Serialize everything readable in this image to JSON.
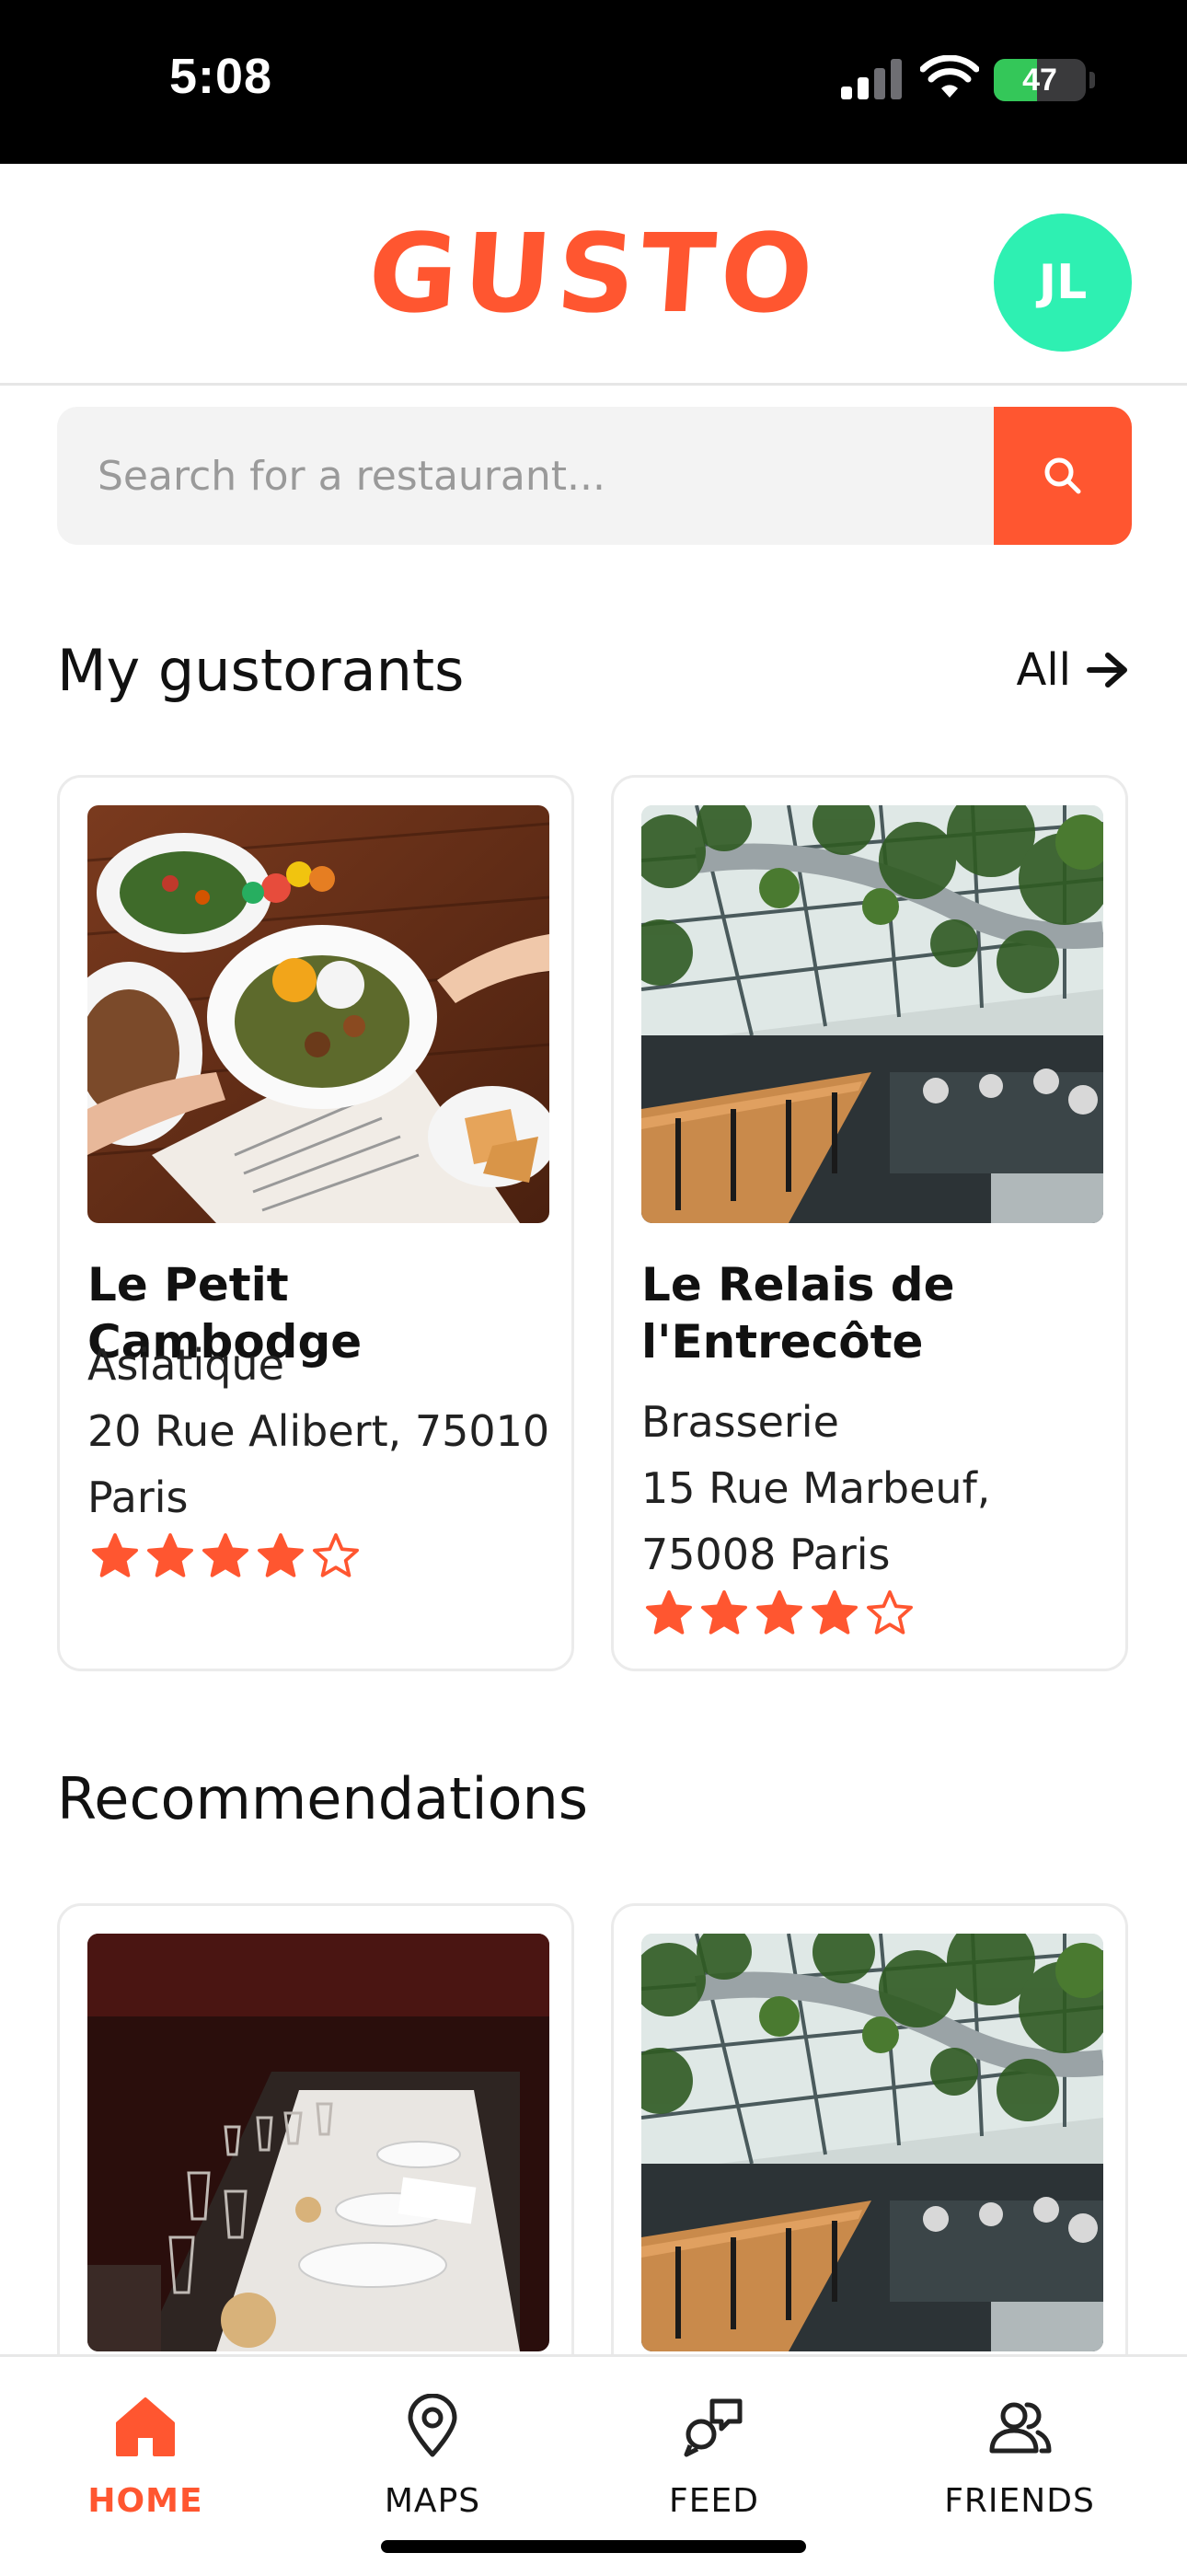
{
  "status_bar": {
    "time": "5:08",
    "battery": "47",
    "battery_level": 0.47
  },
  "header": {
    "logo": "GUSTO",
    "avatar_initials": "JL"
  },
  "search": {
    "placeholder": "Search for a restaurant..."
  },
  "my_gustorants": {
    "title": "My gustorants",
    "see_all_label": "All",
    "cards": [
      {
        "name": "Le Petit Cambodge",
        "cuisine": "Asiatique",
        "address": "20 Rue Alibert, 75010 Paris",
        "rating": 4,
        "max_rating": 5
      },
      {
        "name": "Le Relais de l'Entrecôte",
        "cuisine": "Brasserie",
        "address": "15 Rue Marbeuf, 75008 Paris",
        "rating": 4,
        "max_rating": 5
      }
    ]
  },
  "recommendations": {
    "title": "Recommendations"
  },
  "tabs": [
    {
      "label": "HOME",
      "icon": "home-icon",
      "active": true
    },
    {
      "label": "MAPS",
      "icon": "map-pin-icon",
      "active": false
    },
    {
      "label": "FEED",
      "icon": "chat-bubbles-icon",
      "active": false
    },
    {
      "label": "FRIENDS",
      "icon": "users-icon",
      "active": false
    }
  ],
  "colors": {
    "accent": "#ff5630",
    "avatar": "#2ef0b2",
    "battery": "#34c759"
  }
}
